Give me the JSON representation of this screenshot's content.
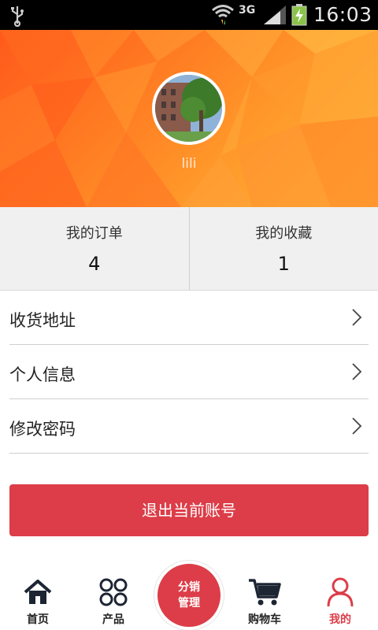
{
  "status_bar": {
    "network": "3G",
    "time": "16:03",
    "icons": [
      "usb-icon",
      "wifi-icon",
      "signal-icon",
      "battery-charging-icon"
    ]
  },
  "profile": {
    "username": "lili",
    "avatar": "building-and-tree-photo"
  },
  "stats": [
    {
      "label": "我的订单",
      "value": "4"
    },
    {
      "label": "我的收藏",
      "value": "1"
    }
  ],
  "menu": [
    {
      "label": "收货地址",
      "icon": "chevron-right-icon"
    },
    {
      "label": "个人信息",
      "icon": "chevron-right-icon"
    },
    {
      "label": "修改密码",
      "icon": "chevron-right-icon"
    }
  ],
  "logout_label": "退出当前账号",
  "tabbar": {
    "tabs": [
      {
        "label": "首页",
        "icon": "home-icon"
      },
      {
        "label": "产品",
        "icon": "products-grid-icon"
      },
      {
        "label": "购物车",
        "icon": "cart-icon"
      },
      {
        "label": "我的",
        "icon": "user-icon",
        "active": true
      }
    ],
    "center": {
      "line1": "分销",
      "line2": "管理"
    }
  },
  "colors": {
    "accent": "#dc3d48",
    "header_orange": "#ff7b22",
    "stats_bg": "#f0f0f0"
  }
}
